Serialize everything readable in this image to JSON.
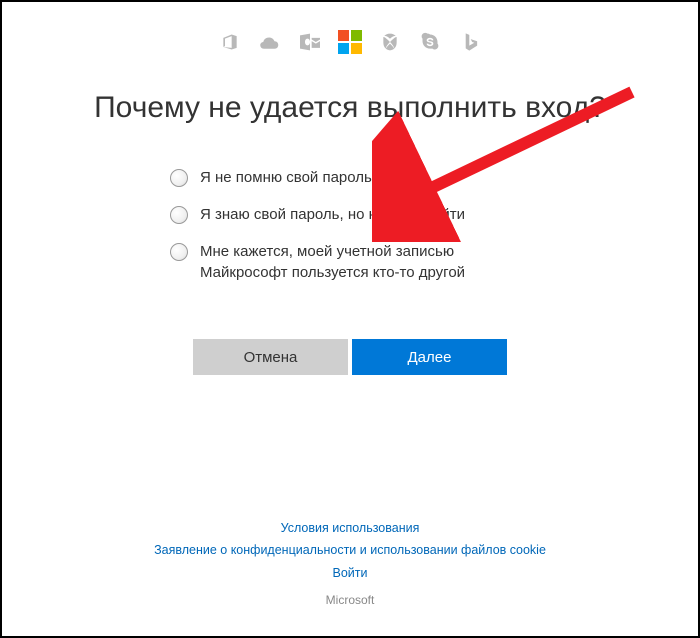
{
  "title": "Почему не удается выполнить вход?",
  "header_icons": {
    "office": "office-icon",
    "onedrive": "onedrive-icon",
    "outlook": "outlook-icon",
    "microsoft": "microsoft-logo-icon",
    "xbox": "xbox-icon",
    "skype": "skype-icon",
    "bing": "bing-icon"
  },
  "options": [
    {
      "label": "Я не помню свой пароль"
    },
    {
      "label": "Я знаю свой пароль, но не могу войти"
    },
    {
      "label": "Мне кажется, моей учетной записью Майкрософт пользуется кто-то другой"
    }
  ],
  "buttons": {
    "cancel": "Отмена",
    "next": "Далее"
  },
  "footer": {
    "terms": "Условия использования",
    "privacy": "Заявление о конфиденциальности и использовании файлов cookie",
    "signin": "Войти",
    "brand": "Microsoft"
  },
  "colors": {
    "accent": "#0078d7",
    "arrow": "#ed1c24"
  }
}
